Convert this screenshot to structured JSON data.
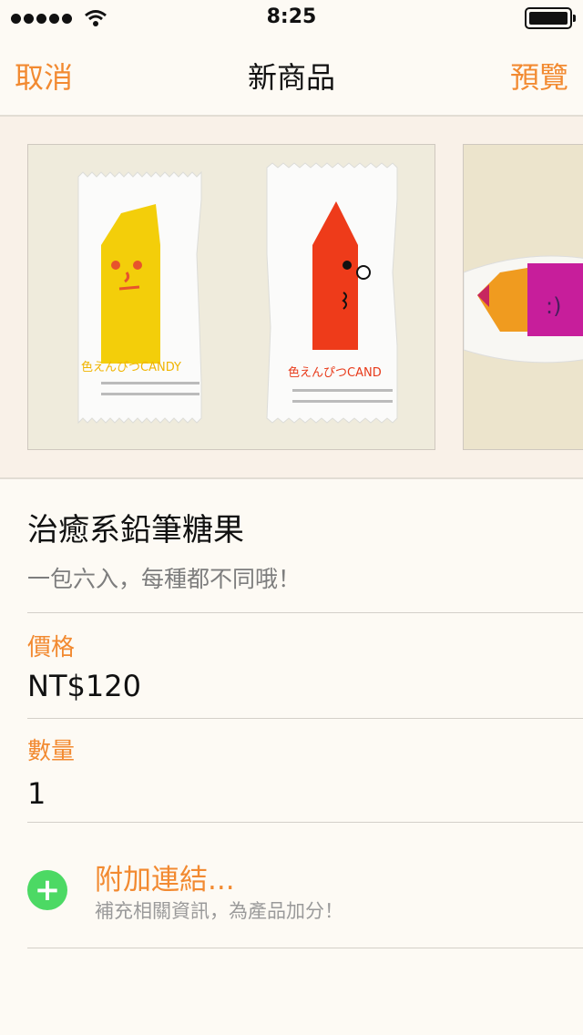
{
  "status_bar": {
    "time": "8:25"
  },
  "nav": {
    "cancel": "取消",
    "title": "新商品",
    "preview": "預覽"
  },
  "product": {
    "name": "治癒系鉛筆糖果",
    "description": "一包六入，每種都不同哦！",
    "images": [
      {
        "candy_labels": [
          "色えんぴつCANDY",
          "色えんぴつCAND"
        ]
      },
      {
        "candy_labels": []
      }
    ]
  },
  "price": {
    "label": "價格",
    "value": "NT$120"
  },
  "quantity": {
    "label": "數量",
    "value": "1"
  },
  "add_link": {
    "title": "附加連結...",
    "subtitle": "補充相關資訊，為產品加分！",
    "icon": "plus-icon"
  },
  "colors": {
    "accent": "#f28a31",
    "add_green": "#4cd964",
    "background": "#fdfaf4"
  }
}
